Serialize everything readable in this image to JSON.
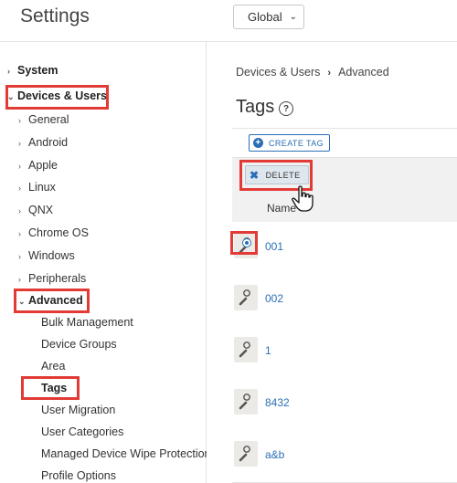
{
  "header": {
    "title": "Settings",
    "scope_value": "Global"
  },
  "sidebar": {
    "items": [
      {
        "label": "System",
        "caret": "›"
      },
      {
        "label": "Devices & Users",
        "caret": "⌄"
      },
      {
        "label": "General",
        "caret": "›"
      },
      {
        "label": "Android",
        "caret": "›"
      },
      {
        "label": "Apple",
        "caret": "›"
      },
      {
        "label": "Linux",
        "caret": "›"
      },
      {
        "label": "QNX",
        "caret": "›"
      },
      {
        "label": "Chrome OS",
        "caret": "›"
      },
      {
        "label": "Windows",
        "caret": "›"
      },
      {
        "label": "Peripherals",
        "caret": "›"
      },
      {
        "label": "Advanced",
        "caret": "⌄"
      },
      {
        "label": "Bulk Management"
      },
      {
        "label": "Device Groups"
      },
      {
        "label": "Area"
      },
      {
        "label": "Tags"
      },
      {
        "label": "User Migration"
      },
      {
        "label": "User Categories"
      },
      {
        "label": "Managed Device Wipe Protection"
      },
      {
        "label": "Profile Options"
      }
    ]
  },
  "main": {
    "breadcrumb": {
      "parent": "Devices & Users",
      "separator": "›",
      "current": "Advanced"
    },
    "title": "Tags",
    "help_icon": "?",
    "create_label": "CREATE TAG",
    "delete_label": "DELETE",
    "column_name": "Name",
    "rows": [
      "001",
      "002",
      "1",
      "8432",
      "a&b"
    ]
  },
  "icons": {
    "plus": "plus-circle-icon",
    "delete": "x-icon",
    "help": "question-circle-icon",
    "tag": "user-tag-icon",
    "cursor": "hand-pointer-icon"
  },
  "colors": {
    "accent": "#2a6fb5",
    "highlight": "#e23b36",
    "header_bg": "#f1f1f1"
  }
}
